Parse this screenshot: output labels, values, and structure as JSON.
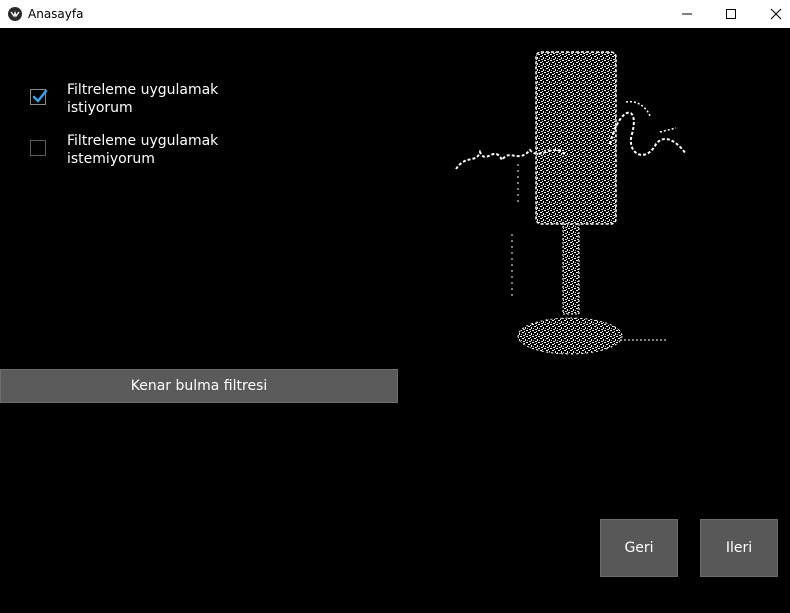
{
  "window": {
    "title": "Anasayfa"
  },
  "options": [
    {
      "label": "Filtreleme uygulamak\n istiyorum",
      "checked": true
    },
    {
      "label": "Filtreleme uygulamak\n istemiyorum",
      "checked": false
    }
  ],
  "filter_button": {
    "label": "Kenar bulma filtresi"
  },
  "nav": {
    "back_label": "Geri",
    "next_label": "Ileri"
  },
  "colors": {
    "background": "#000000",
    "button": "#585858",
    "checkmark": "#3a9ee6"
  }
}
